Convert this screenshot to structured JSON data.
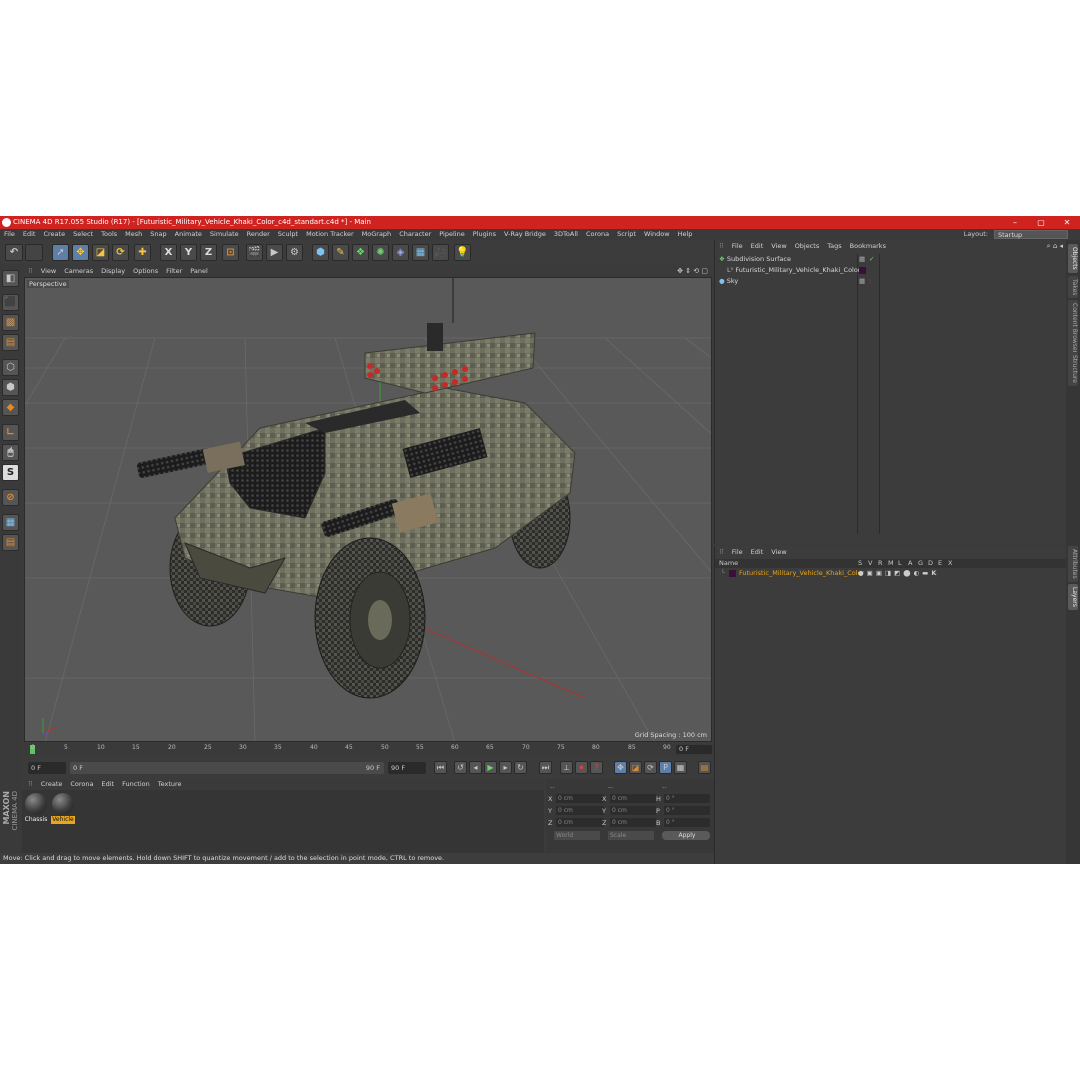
{
  "window": {
    "title": "CINEMA 4D R17.055 Studio (R17) - [Futuristic_Military_Vehicle_Khaki_Color_c4d_standart.c4d *] - Main",
    "minimize": "–",
    "maximize": "▢",
    "close": "✕"
  },
  "menubar": {
    "items": [
      "File",
      "Edit",
      "Create",
      "Select",
      "Tools",
      "Mesh",
      "Snap",
      "Animate",
      "Simulate",
      "Render",
      "Sculpt",
      "Motion Tracker",
      "MoGraph",
      "Character",
      "Pipeline",
      "Plugins",
      "V-Ray Bridge",
      "3DToAll",
      "Corona",
      "Script",
      "Window",
      "Help"
    ],
    "layout_label": "Layout:",
    "layout_value": "Startup"
  },
  "toolbar": {
    "axis_x": "X",
    "axis_y": "Y",
    "axis_z": "Z"
  },
  "viewport": {
    "menu": [
      "View",
      "Cameras",
      "Display",
      "Options",
      "Filter",
      "Panel"
    ],
    "label": "Perspective",
    "grid_spacing": "Grid Spacing : 100 cm"
  },
  "timeline": {
    "ticks": [
      "0",
      "5",
      "10",
      "15",
      "20",
      "25",
      "30",
      "35",
      "40",
      "45",
      "50",
      "55",
      "60",
      "65",
      "70",
      "75",
      "80",
      "85",
      "90"
    ],
    "frame_field": "0 F"
  },
  "transport": {
    "start_frame": "0 F",
    "current_frame": "0 F",
    "end_frame": "90 F",
    "max_frame": "90 F"
  },
  "material_manager": {
    "menu": [
      "Create",
      "Corona",
      "Edit",
      "Function",
      "Texture"
    ],
    "materials": [
      {
        "name": "Chassis"
      },
      {
        "name": "Vehicle"
      }
    ]
  },
  "coordinates": {
    "header1": "--",
    "header2": "--",
    "header3": "--",
    "rows": [
      {
        "a": "X",
        "av": "0 cm",
        "b": "X",
        "bv": "0 cm",
        "c": "H",
        "cv": "0 °"
      },
      {
        "a": "Y",
        "av": "0 cm",
        "b": "Y",
        "bv": "0 cm",
        "c": "P",
        "cv": "0 °"
      },
      {
        "a": "Z",
        "av": "0 cm",
        "b": "Z",
        "bv": "0 cm",
        "c": "B",
        "cv": "0 °"
      }
    ],
    "mode1": "World",
    "mode2": "Scale",
    "apply": "Apply"
  },
  "object_manager": {
    "menu": [
      "File",
      "Edit",
      "View",
      "Objects",
      "Tags",
      "Bookmarks"
    ],
    "objects": [
      {
        "name": "Subdivision Surface"
      },
      {
        "name": "Futuristic_Military_Vehicle_Khaki_Color"
      },
      {
        "name": "Sky"
      }
    ]
  },
  "layer_manager": {
    "menu": [
      "File",
      "Edit",
      "View"
    ],
    "header_name": "Name",
    "columns": [
      "S",
      "V",
      "R",
      "M",
      "L",
      "A",
      "G",
      "D",
      "E",
      "X"
    ],
    "layers": [
      {
        "name": "Futuristic_Military_Vehicle_Khaki_Color"
      }
    ]
  },
  "right_tabs": [
    "Objects",
    "Takes",
    "Content Browser",
    "Structure",
    "Attributes",
    "Layers"
  ],
  "branding": {
    "maxon": "MAXON",
    "cinema": "CINEMA 4D"
  },
  "status": "Move: Click and drag to move elements. Hold down SHIFT to quantize movement / add to the selection in point mode, CTRL to remove.",
  "colors": {
    "titlebar": "#d0231f",
    "selection": "#e8a51d",
    "accent_blue": "#5d7fa8"
  }
}
